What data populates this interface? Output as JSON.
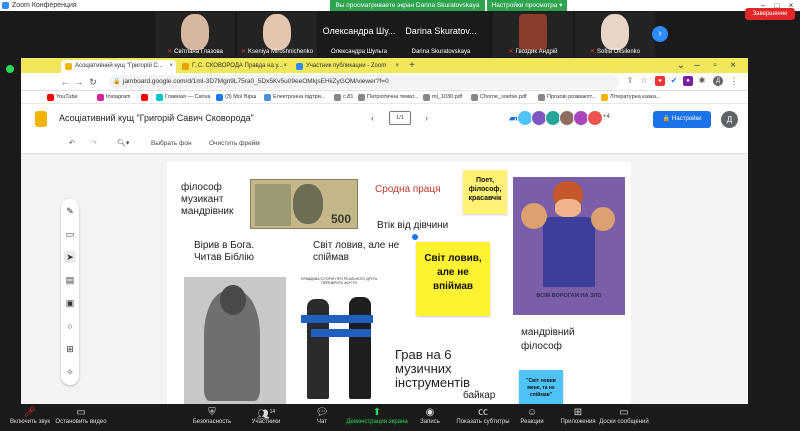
{
  "zoom": {
    "title": "Zoom Конференция",
    "sharing_banner": "Вы просматриваете экран Darina Skuratovskaya",
    "view_options": "Настройки просмотра",
    "participants": [
      {
        "name": "Світлана Глазова"
      },
      {
        "name": "Kseniya Miroshnichenko"
      },
      {
        "name": "Олександра Шульга",
        "big": "Олександра Шу..."
      },
      {
        "name": "Darina Skuratovskaya",
        "big": "Darina Skuratov..."
      },
      {
        "name": "Гвоздик Андрій"
      },
      {
        "name": "Sofiia Oksilenko"
      }
    ],
    "controls": [
      {
        "label": "Включить звук"
      },
      {
        "label": "Остановить видео"
      },
      {
        "label": "Безопасность"
      },
      {
        "label": "Участники",
        "count": "14"
      },
      {
        "label": "Чат"
      },
      {
        "label": "Демонстрация экрана"
      },
      {
        "label": "Запись"
      },
      {
        "label": "Показать субтитры"
      },
      {
        "label": "Реакции"
      },
      {
        "label": "Приложения"
      },
      {
        "label": "Доски сообщений"
      }
    ],
    "end_button": "Завершение"
  },
  "browser": {
    "tabs": [
      {
        "label": "Асоціативний кущ \"Григорій С...",
        "color": "#f5b400"
      },
      {
        "label": "Г. С. СКОВОРОДА Правда на у...",
        "color": "#e8a000"
      },
      {
        "label": "Участник публикации - Zoom",
        "color": "#2d8cff"
      }
    ],
    "url": "jamboard.google.com/d/1mI-3D7Mgn9L75ra0_5Dx5Kv5u09eeOMkjsEHiiZyGOM/viewer?f=0",
    "bookmarks": [
      {
        "label": "YouTube",
        "color": "#ff0000"
      },
      {
        "label": "Instagram",
        "color": "#d6249f"
      },
      {
        "label": "",
        "color": "#ff0000"
      },
      {
        "label": "Главная — Canva",
        "color": "#00c4cc"
      },
      {
        "label": "(3) Мої Вірш",
        "color": "#1877f2"
      },
      {
        "label": "Електронна підтри...",
        "color": "#4a90d9"
      },
      {
        "label": "c.81",
        "color": "#888888"
      },
      {
        "label": "Патріотична темат...",
        "color": "#888888"
      },
      {
        "label": "ml_1030.pdf",
        "color": "#888888"
      },
      {
        "label": "Chorne_soetse.pdf",
        "color": "#888888"
      },
      {
        "label": "Прозові розважлт...",
        "color": "#888888"
      },
      {
        "label": "Літературна казка...",
        "color": "#f5b400"
      }
    ]
  },
  "jamboard": {
    "title": "Асоціативний кущ \"Григорій Савич Сковорода\"",
    "frame_indicator": "1/1",
    "share_button": "Настройки Доступа",
    "more_users": "+4",
    "me_initial": "Д",
    "toolbar": {
      "bg_button": "Выбрать фон",
      "clear_button": "Очистить фрейм"
    },
    "board": {
      "philosopher_text": "філософ\nмузикант\nмандрівник",
      "banknote_value": "500",
      "kindred_work": "Сродна праця",
      "sticky_yellow_small": "Поет, філософ, красавчік",
      "belief_text": "Вірив в Бога.\nЧитав Біблію",
      "escaped_girl": "Втік від дівчини",
      "world_caught": "Світ ловив, але не\nспіймав",
      "sticky_yellow_big": "Світ ловив, але не впіймав",
      "wanderer_philosopher": "мандрівний\nфілософ",
      "instruments": "Грав на 6\nмузичних\nінструментів",
      "bike": "байкар",
      "sticky_cyan": "\"Світ ловив мене, та не спіймав\"",
      "book_title": "ВСІМ ВОРОГАМ НА ЗЛО",
      "poster_caption": "ПРАВДИВА ІСТОРІЯ ПРО РЕАЛЬНОГО ДРУГА ПЕРЕВІРИТЬ ЖИТТЯ"
    }
  }
}
